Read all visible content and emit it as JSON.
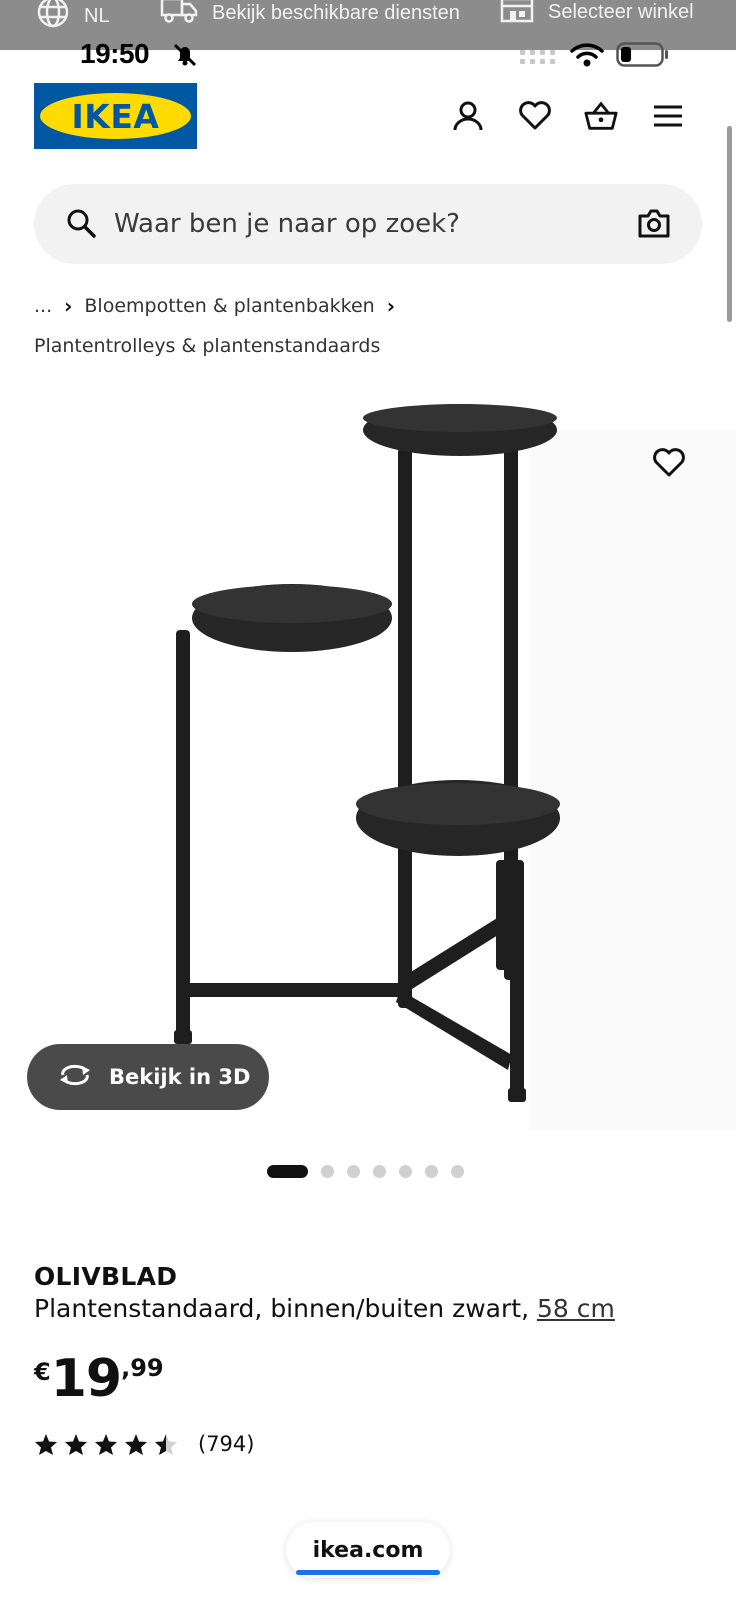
{
  "browser_topband": {
    "language": "NL",
    "services": "Bekijk beschikbare diensten",
    "store": "Selecteer winkel"
  },
  "statusbar": {
    "time": "19:50",
    "icons": [
      "bell-off-icon",
      "signal-icon",
      "wifi-icon",
      "battery-icon"
    ]
  },
  "header": {
    "logo_text": "IKEA",
    "brand_colors": {
      "blue": "#0058a3",
      "yellow": "#ffdb00"
    },
    "icons": [
      "user-icon",
      "heart-icon",
      "basket-icon",
      "menu-icon"
    ]
  },
  "search": {
    "placeholder": "Waar ben je naar op zoek?"
  },
  "breadcrumb": {
    "ellipsis": "...",
    "level1": "Bloempotten & plantenbakken",
    "level2": "Plantentrolleys & plantenstandaards"
  },
  "gallery": {
    "view3d_label": "Bekijk in 3D",
    "image_count": 7,
    "active_index": 0
  },
  "product": {
    "name": "OLIVBLAD",
    "description": "Plantenstandaard, binnen/buiten zwart,",
    "size": "58 cm",
    "price_currency": "€",
    "price_integer": "19",
    "price_decimal": ",99",
    "rating_value": 4.5,
    "rating_max": 5,
    "rating_count": "(794)"
  },
  "browser": {
    "url": "ikea.com"
  }
}
